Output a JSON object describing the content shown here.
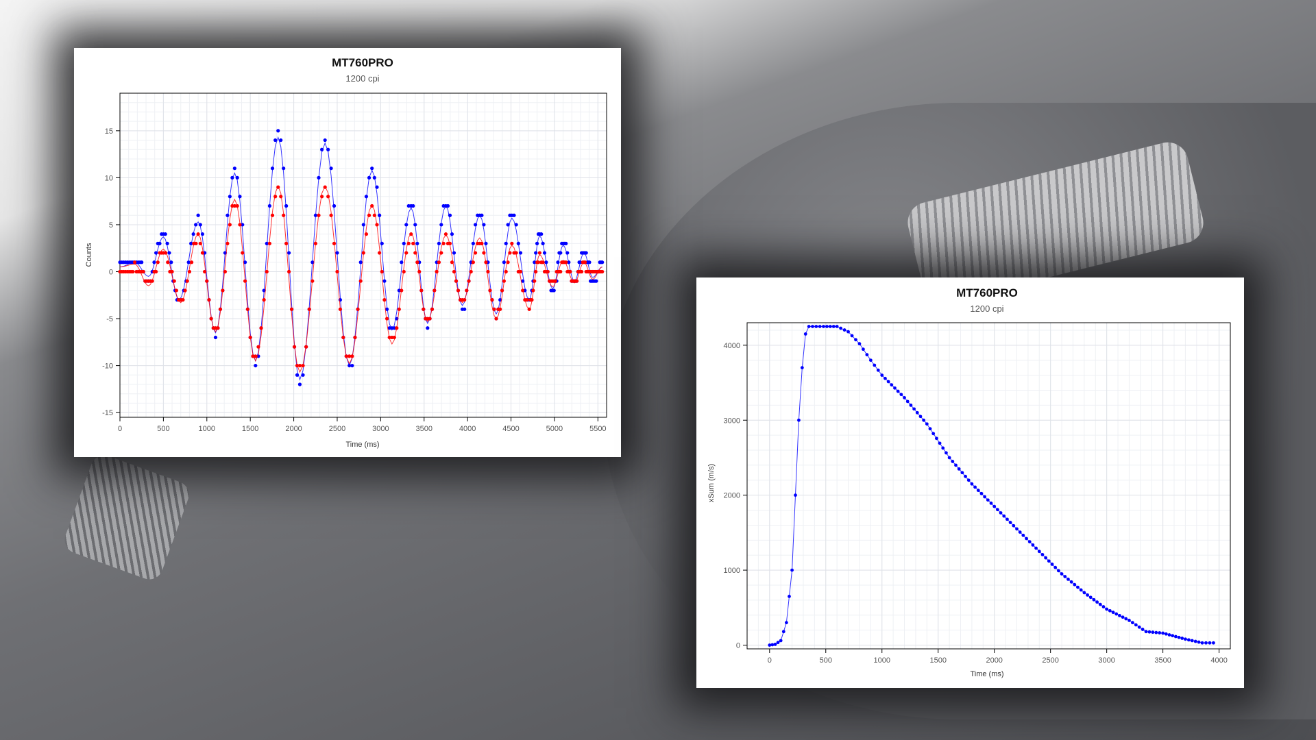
{
  "chart_data": [
    {
      "type": "scatter",
      "title": "MT760PRO",
      "subtitle": "1200 cpi",
      "xlabel": "Time (ms)",
      "ylabel": "Counts",
      "xlim": [
        0,
        5600
      ],
      "ylim": [
        -15.5,
        19
      ],
      "xticks": [
        0,
        500,
        1000,
        1500,
        2000,
        2500,
        3000,
        3500,
        4000,
        4500,
        5000,
        5500
      ],
      "yticks": [
        -15,
        -10,
        -5,
        0,
        5,
        10,
        15
      ],
      "grid": true,
      "colors": {
        "blue": "#0000ff",
        "red": "#ff0000"
      },
      "series": [
        {
          "color": "#0000ff",
          "points": [
            [
              0,
              0.5
            ],
            [
              170,
              1
            ],
            [
              330,
              -0.5
            ],
            [
              500,
              3.7
            ],
            [
              680,
              -3
            ],
            [
              900,
              5.3
            ],
            [
              1100,
              -6.5
            ],
            [
              1320,
              10.5
            ],
            [
              1560,
              -9.5
            ],
            [
              1820,
              14.3
            ],
            [
              2070,
              -11.5
            ],
            [
              2360,
              13.7
            ],
            [
              2640,
              -10
            ],
            [
              2900,
              10.8
            ],
            [
              3130,
              -6.2
            ],
            [
              3350,
              6.8
            ],
            [
              3540,
              -5.5
            ],
            [
              3750,
              7
            ],
            [
              3940,
              -3.6
            ],
            [
              4140,
              6
            ],
            [
              4330,
              -4.5
            ],
            [
              4510,
              5.7
            ],
            [
              4710,
              -3
            ],
            [
              4830,
              3.8
            ],
            [
              4980,
              -1.8
            ],
            [
              5100,
              2.8
            ],
            [
              5230,
              -1
            ],
            [
              5340,
              2
            ],
            [
              5440,
              -0.6
            ],
            [
              5550,
              0.5
            ]
          ]
        },
        {
          "color": "#ff0000",
          "points": [
            [
              0,
              0.5
            ],
            [
              170,
              0.8
            ],
            [
              330,
              -1.5
            ],
            [
              500,
              2.4
            ],
            [
              700,
              -3.3
            ],
            [
              900,
              4
            ],
            [
              1100,
              -6.4
            ],
            [
              1320,
              7.7
            ],
            [
              1560,
              -9.5
            ],
            [
              1820,
              9.1
            ],
            [
              2070,
              -10.7
            ],
            [
              2360,
              9.1
            ],
            [
              2640,
              -9.8
            ],
            [
              2900,
              7.1
            ],
            [
              3130,
              -7.7
            ],
            [
              3350,
              4.1
            ],
            [
              3540,
              -5.3
            ],
            [
              3750,
              3.9
            ],
            [
              3940,
              -3.3
            ],
            [
              4140,
              3.6
            ],
            [
              4330,
              -5
            ],
            [
              4510,
              2.8
            ],
            [
              4710,
              -4
            ],
            [
              4830,
              1.8
            ],
            [
              4980,
              -1.6
            ],
            [
              5100,
              1.2
            ],
            [
              5230,
              -1.2
            ],
            [
              5340,
              1
            ],
            [
              5440,
              -0.8
            ],
            [
              5550,
              0.5
            ]
          ]
        }
      ]
    },
    {
      "type": "line",
      "title": "MT760PRO",
      "subtitle": "1200 cpi",
      "xlabel": "Time (ms)",
      "ylabel": "xSum (m/s)",
      "xlim": [
        -200,
        4100
      ],
      "ylim": [
        -50,
        4300
      ],
      "xticks": [
        0,
        500,
        1000,
        1500,
        2000,
        2500,
        3000,
        3500,
        4000
      ],
      "yticks": [
        0,
        1000,
        2000,
        3000,
        4000
      ],
      "grid": true,
      "colors": {
        "blue": "#0000ff"
      },
      "series": [
        {
          "color": "#0000ff",
          "points": [
            [
              0,
              0
            ],
            [
              50,
              10
            ],
            [
              100,
              60
            ],
            [
              150,
              300
            ],
            [
              200,
              1000
            ],
            [
              230,
              2000
            ],
            [
              260,
              3000
            ],
            [
              290,
              3700
            ],
            [
              320,
              4150
            ],
            [
              350,
              4250
            ],
            [
              480,
              4250
            ],
            [
              600,
              4250
            ],
            [
              700,
              4180
            ],
            [
              800,
              4020
            ],
            [
              900,
              3800
            ],
            [
              1000,
              3600
            ],
            [
              1200,
              3300
            ],
            [
              1400,
              2950
            ],
            [
              1600,
              2500
            ],
            [
              1800,
              2150
            ],
            [
              2000,
              1850
            ],
            [
              2200,
              1550
            ],
            [
              2400,
              1250
            ],
            [
              2600,
              950
            ],
            [
              2800,
              700
            ],
            [
              3000,
              480
            ],
            [
              3200,
              330
            ],
            [
              3350,
              180
            ],
            [
              3500,
              160
            ],
            [
              3700,
              80
            ],
            [
              3850,
              30
            ],
            [
              3950,
              30
            ]
          ]
        }
      ]
    }
  ]
}
